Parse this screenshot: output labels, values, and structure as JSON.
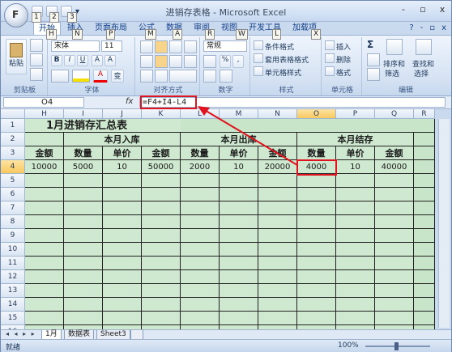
{
  "app": {
    "title": "进销存表格 - Microsoft Excel",
    "office_button_label": "F",
    "keytips": {
      "office": "F",
      "q1": "1",
      "q2": "2",
      "q3": "3",
      "tab_home": "H",
      "tab_insert": "N",
      "tab_layout": "P",
      "tab_formulas": "M",
      "tab_data": "A",
      "tab_review": "R",
      "tab_view": "W",
      "tab_dev": "L",
      "tab_addins": "X"
    },
    "window_controls": [
      "-",
      "▫",
      "x"
    ]
  },
  "ribbon": {
    "tabs": [
      "开始",
      "插入",
      "页面布局",
      "公式",
      "数据",
      "审阅",
      "视图",
      "开发工具",
      "加载项"
    ],
    "active_tab": "开始",
    "help": [
      "?",
      "-",
      "▫",
      "x"
    ],
    "clipboard": {
      "paste": "粘贴",
      "label": "剪贴板"
    },
    "font": {
      "name": "宋体",
      "size": "11",
      "bold": "B",
      "italic": "I",
      "underline": "U",
      "grow": "A",
      "shrink": "A",
      "color_a": "A",
      "pinyin": "变",
      "label": "字体"
    },
    "alignment": {
      "label": "对齐方式"
    },
    "number": {
      "format": "常规",
      "percent": "%",
      "comma": ",",
      "label": "数字"
    },
    "styles": {
      "cond": "条件格式",
      "table": "套用表格格式",
      "cell": "单元格样式",
      "label": "样式"
    },
    "cells": {
      "insert": "插入",
      "delete": "删除",
      "format": "格式",
      "label": "单元格"
    },
    "editing": {
      "sigma": "Σ",
      "sort": "排序和\n筛选",
      "find": "查找和\n选择",
      "sort_l1": "排序和",
      "sort_l2": "筛选",
      "find_l1": "查找和",
      "find_l2": "选择",
      "label": "编辑"
    }
  },
  "formula_bar": {
    "name_box": "O4",
    "fx": "fx",
    "formula": "=F4+I4-L4"
  },
  "sheet": {
    "columns": [
      "H",
      "I",
      "J",
      "K",
      "L",
      "M",
      "N",
      "O",
      "P",
      "Q",
      "R"
    ],
    "selected_column": "O",
    "rows": [
      "1",
      "2",
      "3",
      "4",
      "5",
      "6",
      "7",
      "8",
      "9",
      "10",
      "11",
      "12",
      "13",
      "14",
      "15",
      "16"
    ],
    "selected_row": "4",
    "title": "1月进销存汇总表",
    "group_in": "本月入库",
    "group_out": "本月出库",
    "group_end": "本月结存",
    "headers": [
      "金额",
      "数量",
      "单价",
      "金额",
      "数量",
      "单价",
      "金额",
      "数量",
      "单价",
      "金额"
    ],
    "row4": [
      "10000",
      "5000",
      "10",
      "50000",
      "2000",
      "10",
      "20000",
      "4000",
      "10",
      "40000"
    ]
  },
  "sheet_tabs": {
    "nav": "◂ ◂ ▸ ▸",
    "tabs": [
      "1月",
      "数据表",
      "Sheet3"
    ]
  },
  "status": {
    "ready": "就绪",
    "zoom": "100%"
  }
}
